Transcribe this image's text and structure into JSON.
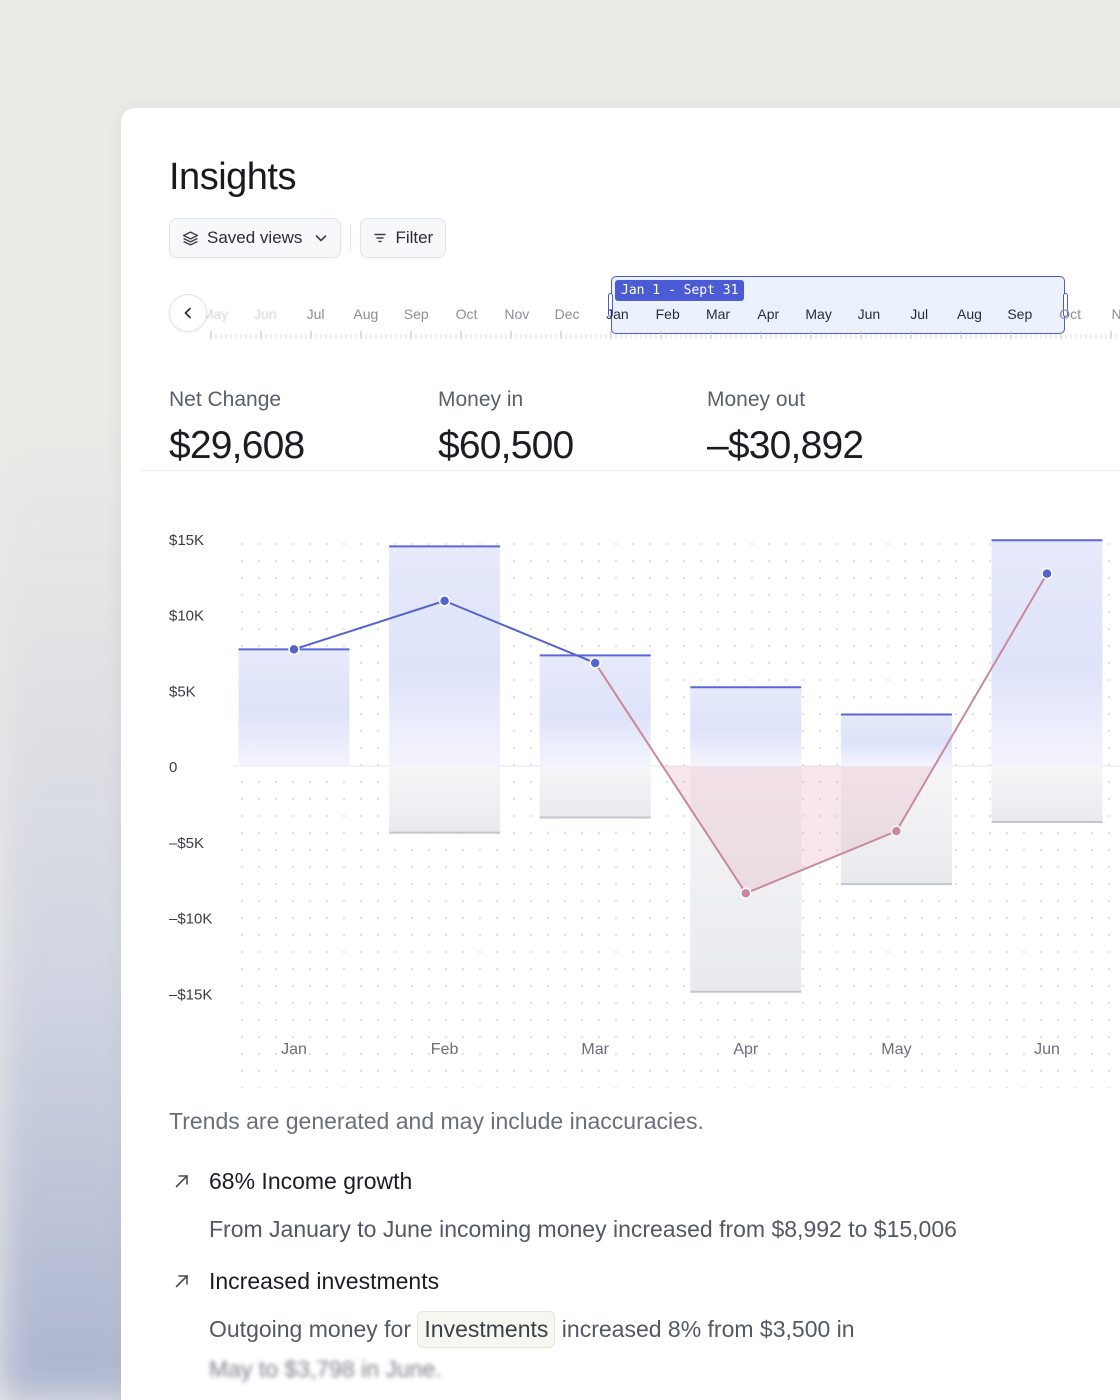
{
  "page": {
    "title": "Insights"
  },
  "toolbar": {
    "saved_views_label": "Saved views",
    "filter_label": "Filter"
  },
  "timeline": {
    "range_label": "Jan 1 - Sept 31",
    "months": [
      "May",
      "Jun",
      "Jul",
      "Aug",
      "Sep",
      "Oct",
      "Nov",
      "Dec",
      "Jan",
      "Feb",
      "Mar",
      "Apr",
      "May",
      "Jun",
      "Jul",
      "Aug",
      "Sep",
      "Oct",
      "No"
    ]
  },
  "metrics": [
    {
      "label": "Net Change",
      "value": "$29,608"
    },
    {
      "label": "Money in",
      "value": "$60,500"
    },
    {
      "label": "Money out",
      "value": "–$30,892"
    }
  ],
  "colors": {
    "accent": "#4b5bd6",
    "positive_line": "#5563cf",
    "negative_line": "#c9899d",
    "bar_edge_in": "#5a67d8",
    "bar_edge_out": "#c3c6cf"
  },
  "chart_data": {
    "type": "bar",
    "categories": [
      "Jan",
      "Feb",
      "Mar",
      "Apr",
      "May",
      "Jun"
    ],
    "y_ticks": [
      "$15K",
      "$10K",
      "$5K",
      "0",
      "–$5K",
      "–$10K",
      "–$15K"
    ],
    "ylim": [
      -15000,
      15000
    ],
    "grid": true,
    "series": [
      {
        "name": "",
        "type": "bar",
        "values": [
          7700,
          14500,
          7300,
          5200,
          3400,
          14900
        ]
      },
      {
        "name": "",
        "type": "bar",
        "values": [
          0,
          -4400,
          -3400,
          -14900,
          -7800,
          -3700
        ]
      },
      {
        "name": "",
        "type": "line",
        "values": [
          7700,
          10900,
          6800,
          -8400,
          -4300,
          12700
        ]
      }
    ]
  },
  "insights": {
    "disclaimer": "Trends are generated and may include inaccuracies.",
    "items": [
      {
        "title": "68% Income growth",
        "body": "From January to June incoming money increased from $8,992 to $15,006"
      },
      {
        "title": "Increased investments",
        "body_prefix": "Outgoing money for",
        "chip": "Investments",
        "body_suffix": "increased 8% from $3,500 in",
        "body_faded": "May to $3,798 in June."
      }
    ]
  }
}
